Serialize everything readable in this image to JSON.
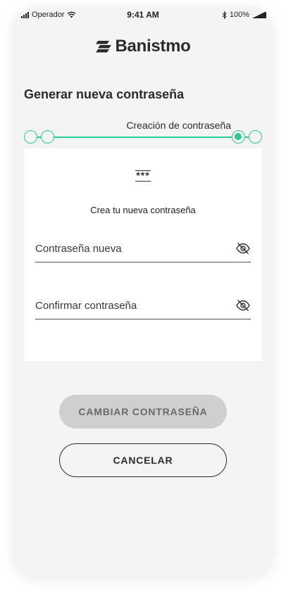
{
  "status_bar": {
    "carrier": "Operador",
    "time": "9:41 AM",
    "battery": "100%"
  },
  "brand": {
    "name": "Banistmo",
    "color": "#2b2b2b"
  },
  "page": {
    "title": "Generar nueva contraseña"
  },
  "stepper": {
    "current_label": "Creación de contraseña",
    "total_steps": 4,
    "active_step": 3,
    "accent": "#2ec98e"
  },
  "card": {
    "icon": "password-asterisks-icon",
    "icon_text": "***",
    "heading": "Crea tu nueva contraseña",
    "fields": [
      {
        "placeholder": "Contraseña nueva",
        "value": "",
        "toggle_icon": "eye-off-icon"
      },
      {
        "placeholder": "Confirmar contraseña",
        "value": "",
        "toggle_icon": "eye-off-icon"
      }
    ]
  },
  "actions": {
    "primary_label": "CAMBIAR CONTRASEÑA",
    "primary_enabled": false,
    "secondary_label": "CANCELAR"
  }
}
